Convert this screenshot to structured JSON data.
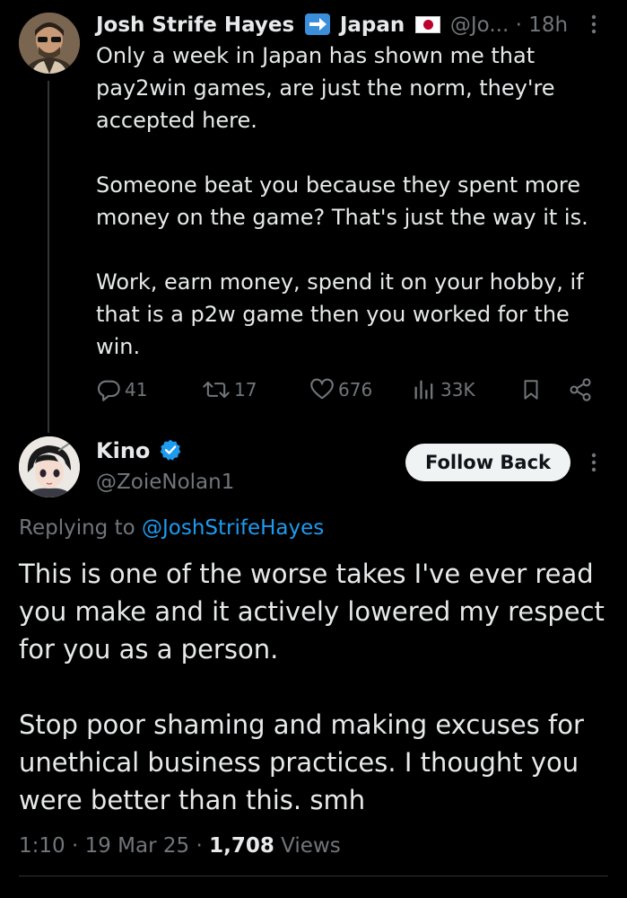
{
  "tweet1": {
    "author_name": "Josh Strife Hayes",
    "name_suffix": "Japan",
    "handle": "@Jo...",
    "time": "· 18h",
    "paragraphs": [
      "Only a week in Japan has shown me that pay2win games, are just the norm, they're accepted here.",
      "Someone beat you because they spent more money on the game? That's just the way it is.",
      "Work, earn money, spend it on your hobby, if that is a p2w game then you worked for the win."
    ],
    "replies": "41",
    "reposts": "17",
    "likes": "676",
    "views": "33K"
  },
  "tweet2": {
    "author_name": "Kino",
    "handle": "@ZoieNolan1",
    "follow_label": "Follow Back",
    "replying_prefix": "Replying to",
    "replying_handle": "@JoshStrifeHayes",
    "paragraphs": [
      "This is one of the worse takes I've ever read you make and it actively lowered my respect for you as a person.",
      "Stop poor shaming and making excuses for unethical business practices. I thought you were better than this. smh"
    ],
    "time": "1:10",
    "date": "19 Mar 25",
    "views_count": "1,708",
    "views_label": "Views"
  },
  "colors": {
    "background": "#000000",
    "text": "#e7e9ea",
    "muted": "#71767b",
    "link": "#1d9bf0"
  }
}
